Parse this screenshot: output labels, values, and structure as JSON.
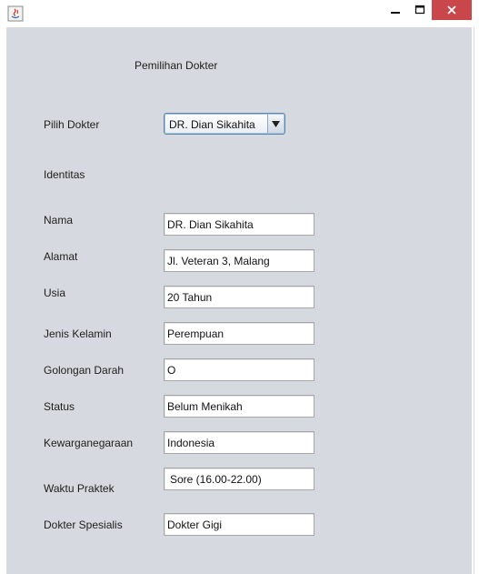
{
  "window": {
    "minimize_glyph": "—",
    "maximize_glyph": "☐",
    "close_glyph": "✕"
  },
  "form": {
    "title": "Pemilihan Dokter",
    "pilih_label": "Pilih Dokter",
    "selected_doctor": "DR. Dian Sikahita",
    "identitas_label": "Identitas"
  },
  "fields": [
    {
      "label": "Nama",
      "value": "DR. Dian Sikahita"
    },
    {
      "label": "Alamat",
      "value": "Jl. Veteran 3, Malang"
    },
    {
      "label": "Usia",
      "value": "20 Tahun"
    },
    {
      "label": "Jenis Kelamin",
      "value": "Perempuan"
    },
    {
      "label": "Golongan Darah",
      "value": "O"
    },
    {
      "label": "Status",
      "value": "Belum Menikah"
    },
    {
      "label": "Kewarganegaraan",
      "value": "Indonesia"
    },
    {
      "label": "Waktu Praktek",
      "value": "Sore (16.00-22.00)"
    },
    {
      "label": "Dokter Spesialis",
      "value": "Dokter Gigi"
    }
  ],
  "colors": {
    "close_button": "#c9474a",
    "panel_background": "#d6d9df",
    "combo_border": "#5b86ad"
  }
}
